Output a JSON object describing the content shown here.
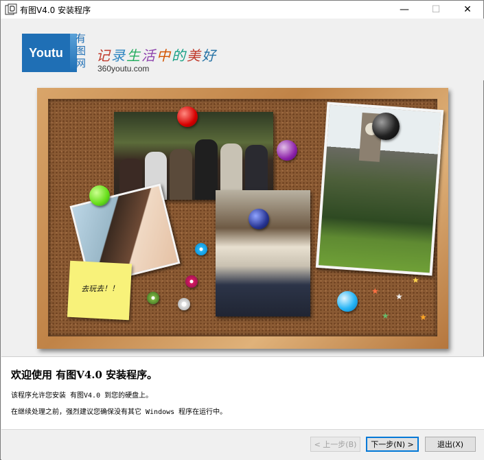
{
  "window": {
    "title": "有图V4.0 安装程序",
    "minimize_label": "—",
    "maximize_label": "☐",
    "close_label": "✕"
  },
  "header": {
    "logo_text": "Youtu",
    "logo_cn": "有图网",
    "slogan": [
      "记",
      "录",
      "生",
      "活",
      "中",
      "的",
      "美",
      "好"
    ],
    "website": "360youtu.com"
  },
  "board": {
    "sticky_note": "去玩去！！",
    "colors": {
      "frame": "#c08347",
      "cork": "#8a5a33",
      "sticky": "#f8f27a"
    }
  },
  "content": {
    "welcome": "欢迎使用 有图V4.0 安装程序。",
    "line1": "该程序允许您安装 有图V4.0 到您的硬盘上。",
    "line2": "在继续处理之前，强烈建议您确保没有其它 Windows 程序在运行中。"
  },
  "footer": {
    "back_label": "< 上一步(B)",
    "next_label": "下一步(N) >",
    "exit_label": "退出(X)"
  }
}
